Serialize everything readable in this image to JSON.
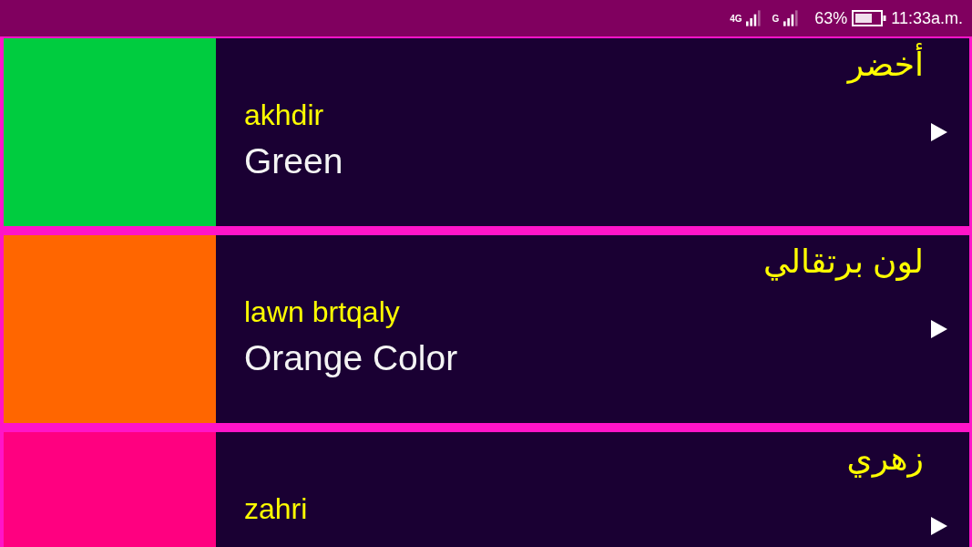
{
  "status_bar": {
    "network_1": "4G",
    "network_2": "G",
    "battery": "63%",
    "time": "11:33a.m."
  },
  "rows": [
    {
      "color": "#00cc3f",
      "arabic": "أخضر",
      "transliteration": "akhdir",
      "english": "Green"
    },
    {
      "color": "#ff6600",
      "arabic": "لون برتقالي",
      "transliteration": "lawn brtqaly",
      "english": "Orange Color"
    },
    {
      "color": "#ff0080",
      "arabic": "زهري",
      "transliteration": "zahri"
    }
  ]
}
